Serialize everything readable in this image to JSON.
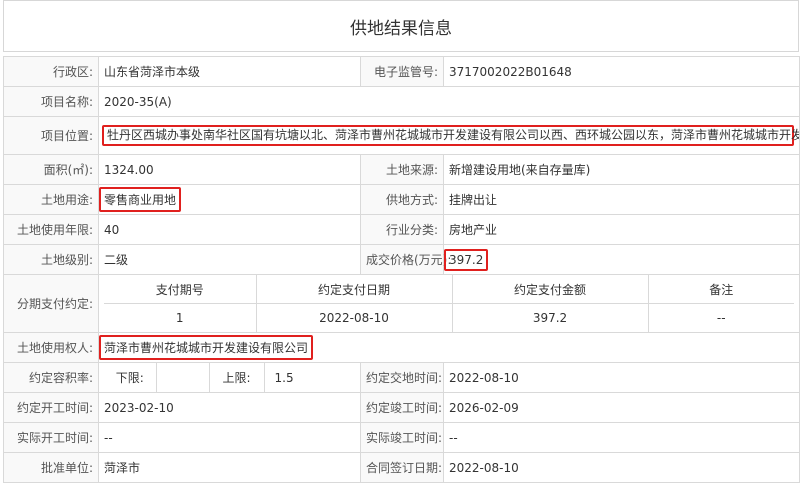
{
  "title": "供地结果信息",
  "fields": {
    "district_label": "行政区:",
    "district_value": "山东省菏泽市本级",
    "supervision_label": "电子监管号:",
    "supervision_value": "3717002022B01648",
    "project_name_label": "项目名称:",
    "project_name_value": "2020-35(A)",
    "location_label": "项目位置:",
    "location_value": "牡丹区西城办事处南华社区国有坑塘以北、菏泽市曹州花城城市开发建设有限公司以西、西环城公园以东，菏泽市曹州花城城市开发建设有限公司以南",
    "area_label": "面积(㎡):",
    "area_value": "1324.00",
    "land_source_label": "土地来源:",
    "land_source_value": "新增建设用地(来自存量库)",
    "land_use_label": "土地用途:",
    "land_use_value": "零售商业用地",
    "supply_method_label": "供地方式:",
    "supply_method_value": "挂牌出让",
    "term_label": "土地使用年限:",
    "term_value": "40",
    "industry_label": "行业分类:",
    "industry_value": "房地产业",
    "grade_label": "土地级别:",
    "grade_value": "二级",
    "price_label": "成交价格(万元):",
    "price_value": "397.2",
    "installment_label": "分期支付约定:",
    "user_label": "土地使用权人:",
    "user_value": "菏泽市曹州花城城市开发建设有限公司",
    "plot_ratio_label": "约定容积率:",
    "plot_lower_label": "下限:",
    "plot_lower_value": "",
    "plot_upper_label": "上限:",
    "plot_upper_value": "1.5",
    "delivery_label": "约定交地时间:",
    "delivery_value": "2022-08-10",
    "start_label": "约定开工时间:",
    "start_value": "2023-02-10",
    "finish_label": "约定竣工时间:",
    "finish_value": "2026-02-09",
    "actual_start_label": "实际开工时间:",
    "actual_start_value": "--",
    "actual_finish_label": "实际竣工时间:",
    "actual_finish_value": "--",
    "approver_label": "批准单位:",
    "approver_value": "菏泽市",
    "contract_label": "合同签订日期:",
    "contract_value": "2022-08-10"
  },
  "installment": {
    "headers": [
      "支付期号",
      "约定支付日期",
      "约定支付金额",
      "备注"
    ],
    "rows": [
      [
        "1",
        "2022-08-10",
        "397.2",
        "--"
      ]
    ]
  },
  "colors": {
    "highlight": "#e0201e",
    "border": "#d9d9d9",
    "label_bg": "#f9f9f9"
  }
}
